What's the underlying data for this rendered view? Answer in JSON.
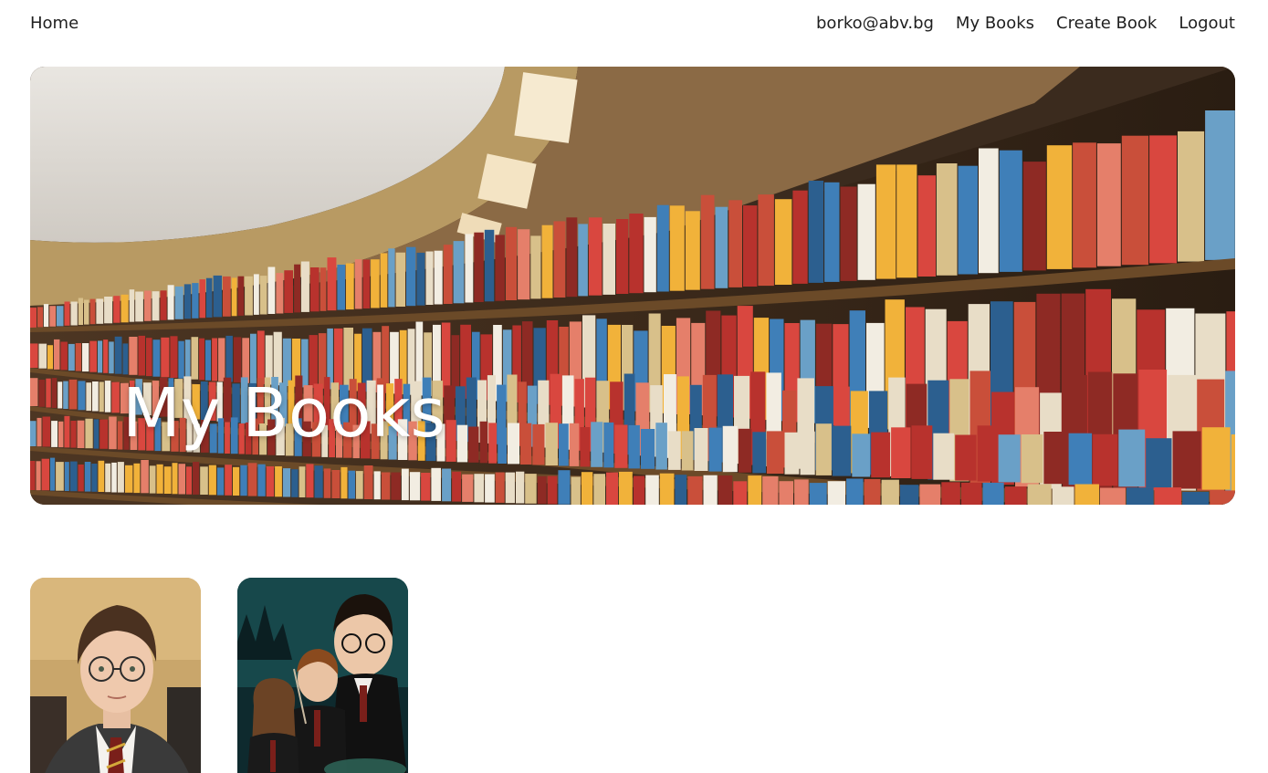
{
  "nav": {
    "home": "Home",
    "user_email": "borko@abv.bg",
    "my_books": "My Books",
    "create_book": "Create Book",
    "logout": "Logout"
  },
  "hero": {
    "title": "My Books"
  },
  "books": [
    {
      "image": "harry-portrait"
    },
    {
      "image": "harry-chamber-poster"
    }
  ]
}
